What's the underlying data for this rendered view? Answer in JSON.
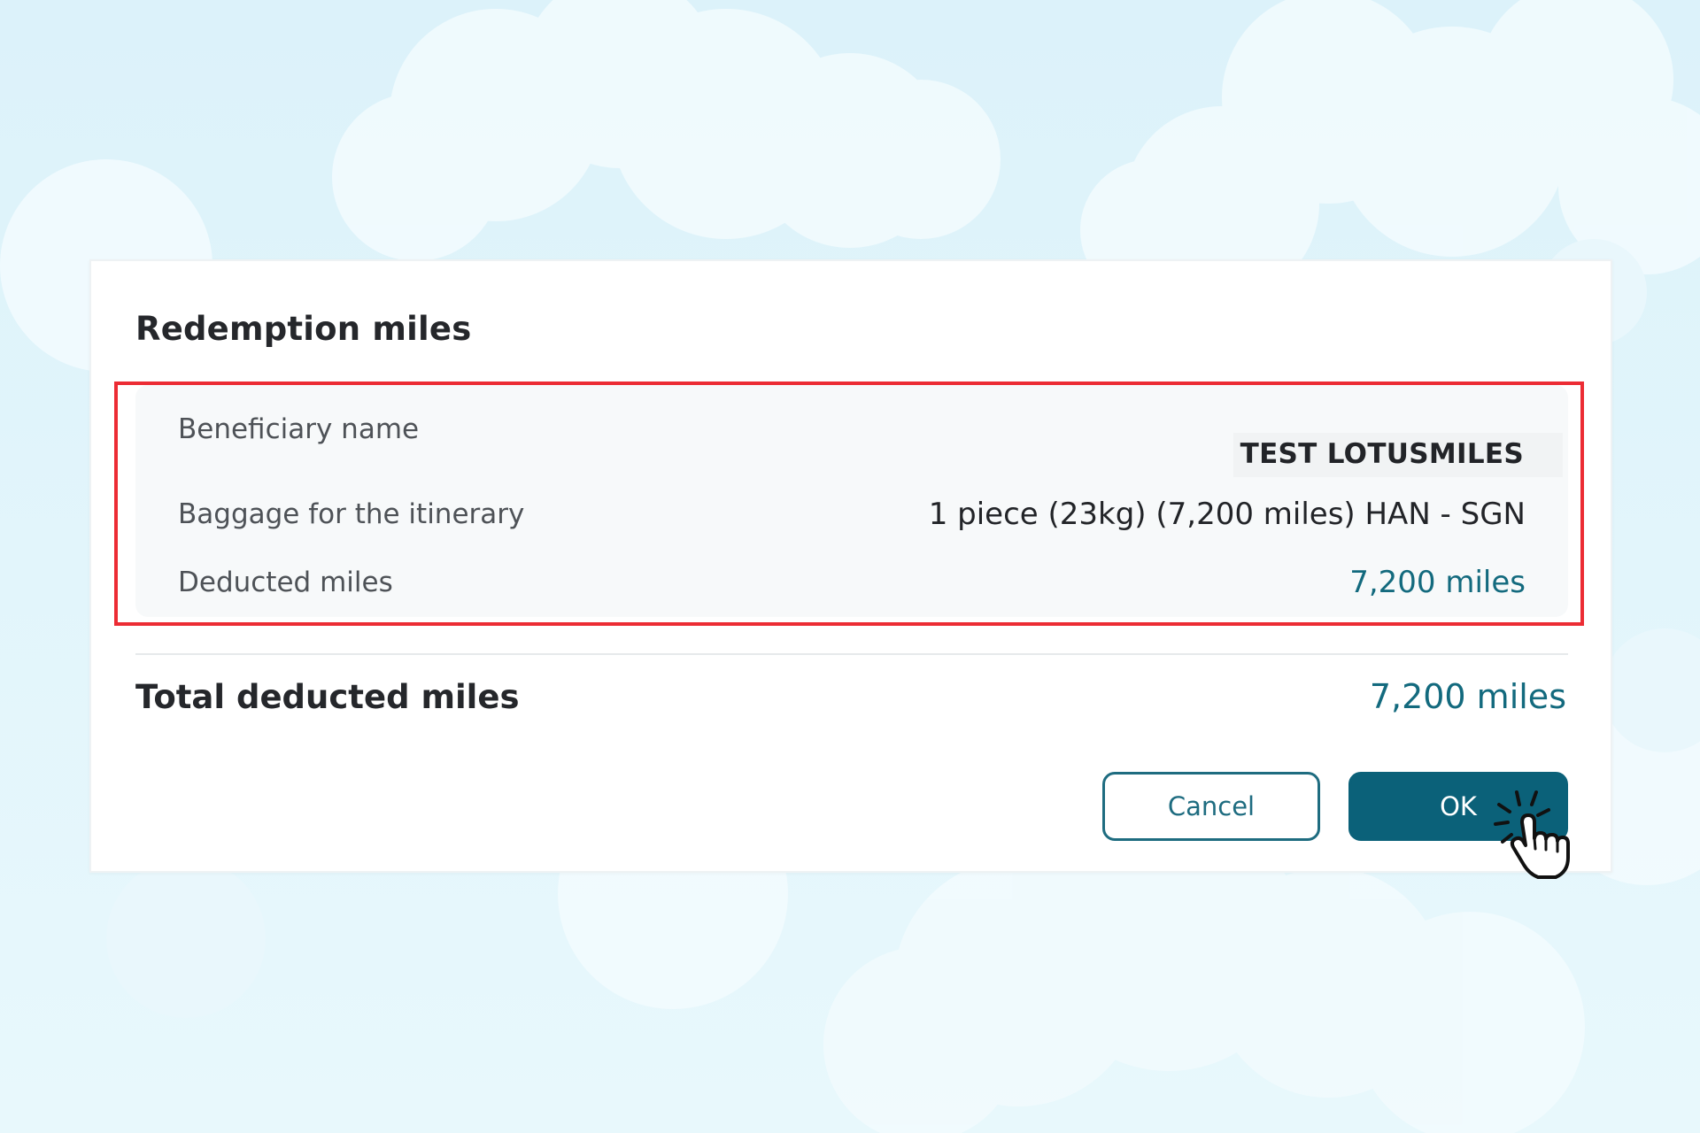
{
  "dialog": {
    "title": "Redemption miles",
    "details": [
      {
        "label": "Beneficiary name",
        "value": "TEST LOTUSMILES"
      },
      {
        "label": "Baggage for the itinerary",
        "value": "1 piece (23kg) (7,200 miles) HAN - SGN"
      },
      {
        "label": "Deducted miles",
        "value": "7,200 miles"
      }
    ],
    "total": {
      "label": "Total deducted miles",
      "value": "7,200 miles"
    },
    "buttons": {
      "cancel": "Cancel",
      "ok": "OK"
    }
  },
  "icons": {
    "cursor": "hand-pointer-click-icon"
  },
  "colors": {
    "accent": "#0b6179",
    "miles_text": "#136a7e",
    "highlight": "#ec2c34",
    "background": "#e2f5fb"
  }
}
